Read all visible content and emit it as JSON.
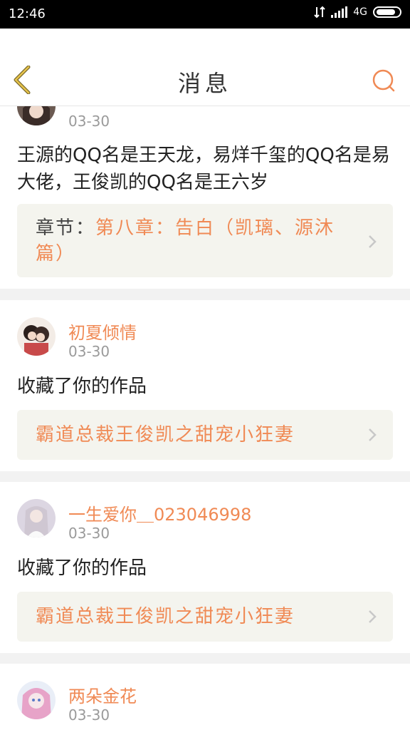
{
  "status_bar": {
    "time": "12:46",
    "network": "4G"
  },
  "header": {
    "title": "消息",
    "back_icon": "back-chevron-icon",
    "search_icon": "search-icon"
  },
  "accent_color": "#f08a55",
  "items": [
    {
      "date": "03-30",
      "message": "王源的QQ名是王天龙，易烊千玺的QQ名是易大佬，王俊凯的QQ名是王六岁",
      "chapter_prefix": "章节：",
      "chapter_title": "第八章：告白（凯璃、源沐篇）"
    },
    {
      "username": "初夏倾情",
      "date": "03-30",
      "message": "收藏了你的作品",
      "work_title": "霸道总裁王俊凯之甜宠小狂妻"
    },
    {
      "username": "一生爱你＿023046998",
      "date": "03-30",
      "message": "收藏了你的作品",
      "work_title": "霸道总裁王俊凯之甜宠小狂妻"
    },
    {
      "username": "两朵金花",
      "date": "03-30"
    }
  ]
}
